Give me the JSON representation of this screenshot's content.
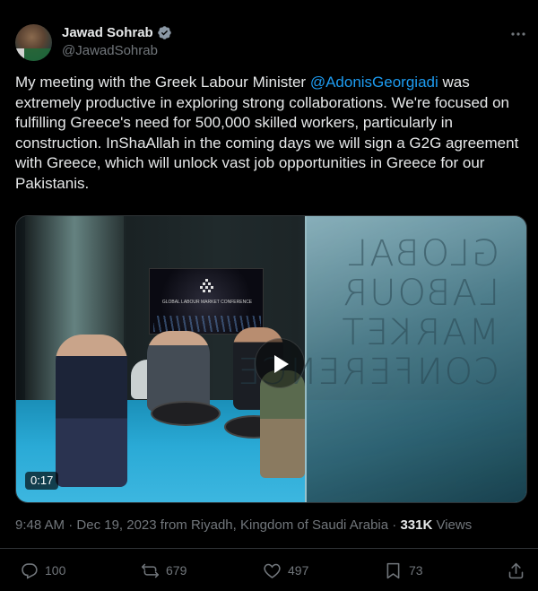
{
  "author": {
    "display_name": "Jawad Sohrab",
    "handle": "@JawadSohrab",
    "verified": true
  },
  "tweet": {
    "text_before_mention": "My meeting with the Greek Labour Minister ",
    "mention": "@AdonisGeorgiadi",
    "text_after_mention": " was extremely productive in exploring strong collaborations. We're focused on fulfilling Greece's need for 500,000 skilled workers, particularly in construction. InShaAllah in the coming days we will sign a G2G agreement with Greece, which will unlock vast job opportunities in Greece for our Pakistanis."
  },
  "media": {
    "type": "video",
    "duration": "0:17",
    "screen_text": "GLOBAL LABOUR MARKET CONFERENCE",
    "glass_text": "GLOBAL LABOUR MARKET CONFERENCE"
  },
  "meta": {
    "time": "9:48 AM",
    "separator": " · ",
    "date": "Dec 19, 2023 from Riyadh, Kingdom of Saudi Arabia",
    "views_count": "331K",
    "views_label": " Views"
  },
  "actions": {
    "replies": "100",
    "reposts": "679",
    "likes": "497",
    "bookmarks": "73"
  },
  "colors": {
    "background": "#000000",
    "text": "#e7e9ea",
    "secondary": "#71767b",
    "accent": "#1d9bf0",
    "divider": "#2f3336"
  },
  "icons": [
    "verified-badge-icon",
    "more-options-icon",
    "play-icon",
    "reply-icon",
    "repost-icon",
    "like-icon",
    "bookmark-icon",
    "share-icon"
  ]
}
